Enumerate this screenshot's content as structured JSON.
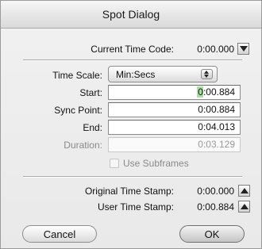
{
  "window": {
    "title": "Spot Dialog"
  },
  "current_time_code": {
    "label": "Current Time Code:",
    "value": "0:00.000"
  },
  "time_scale": {
    "label": "Time Scale:",
    "selected": "Min:Secs"
  },
  "fields": {
    "start": {
      "label": "Start:",
      "cursor_char": "0",
      "rest": ":00.884"
    },
    "sync_point": {
      "label": "Sync Point:",
      "value": "0:00.884"
    },
    "end": {
      "label": "End:",
      "value": "0:04.013"
    },
    "duration": {
      "label": "Duration:",
      "value": "0:03.129"
    }
  },
  "use_subframes": {
    "label": "Use Subframes",
    "checked": false
  },
  "original_time_stamp": {
    "label": "Original Time Stamp:",
    "value": "0:00.000"
  },
  "user_time_stamp": {
    "label": "User Time Stamp:",
    "value": "0:00.884"
  },
  "buttons": {
    "cancel": "Cancel",
    "ok": "OK"
  },
  "icons": {
    "current_time_code_button": "triangle-down-icon",
    "original_time_stamp_button": "triangle-up-icon",
    "user_time_stamp_button": "triangle-up-icon",
    "time_scale_select": "up-down-chevrons-icon"
  },
  "colors": {
    "selection_highlight": "#a7e09f",
    "window_background": "#ececec"
  }
}
